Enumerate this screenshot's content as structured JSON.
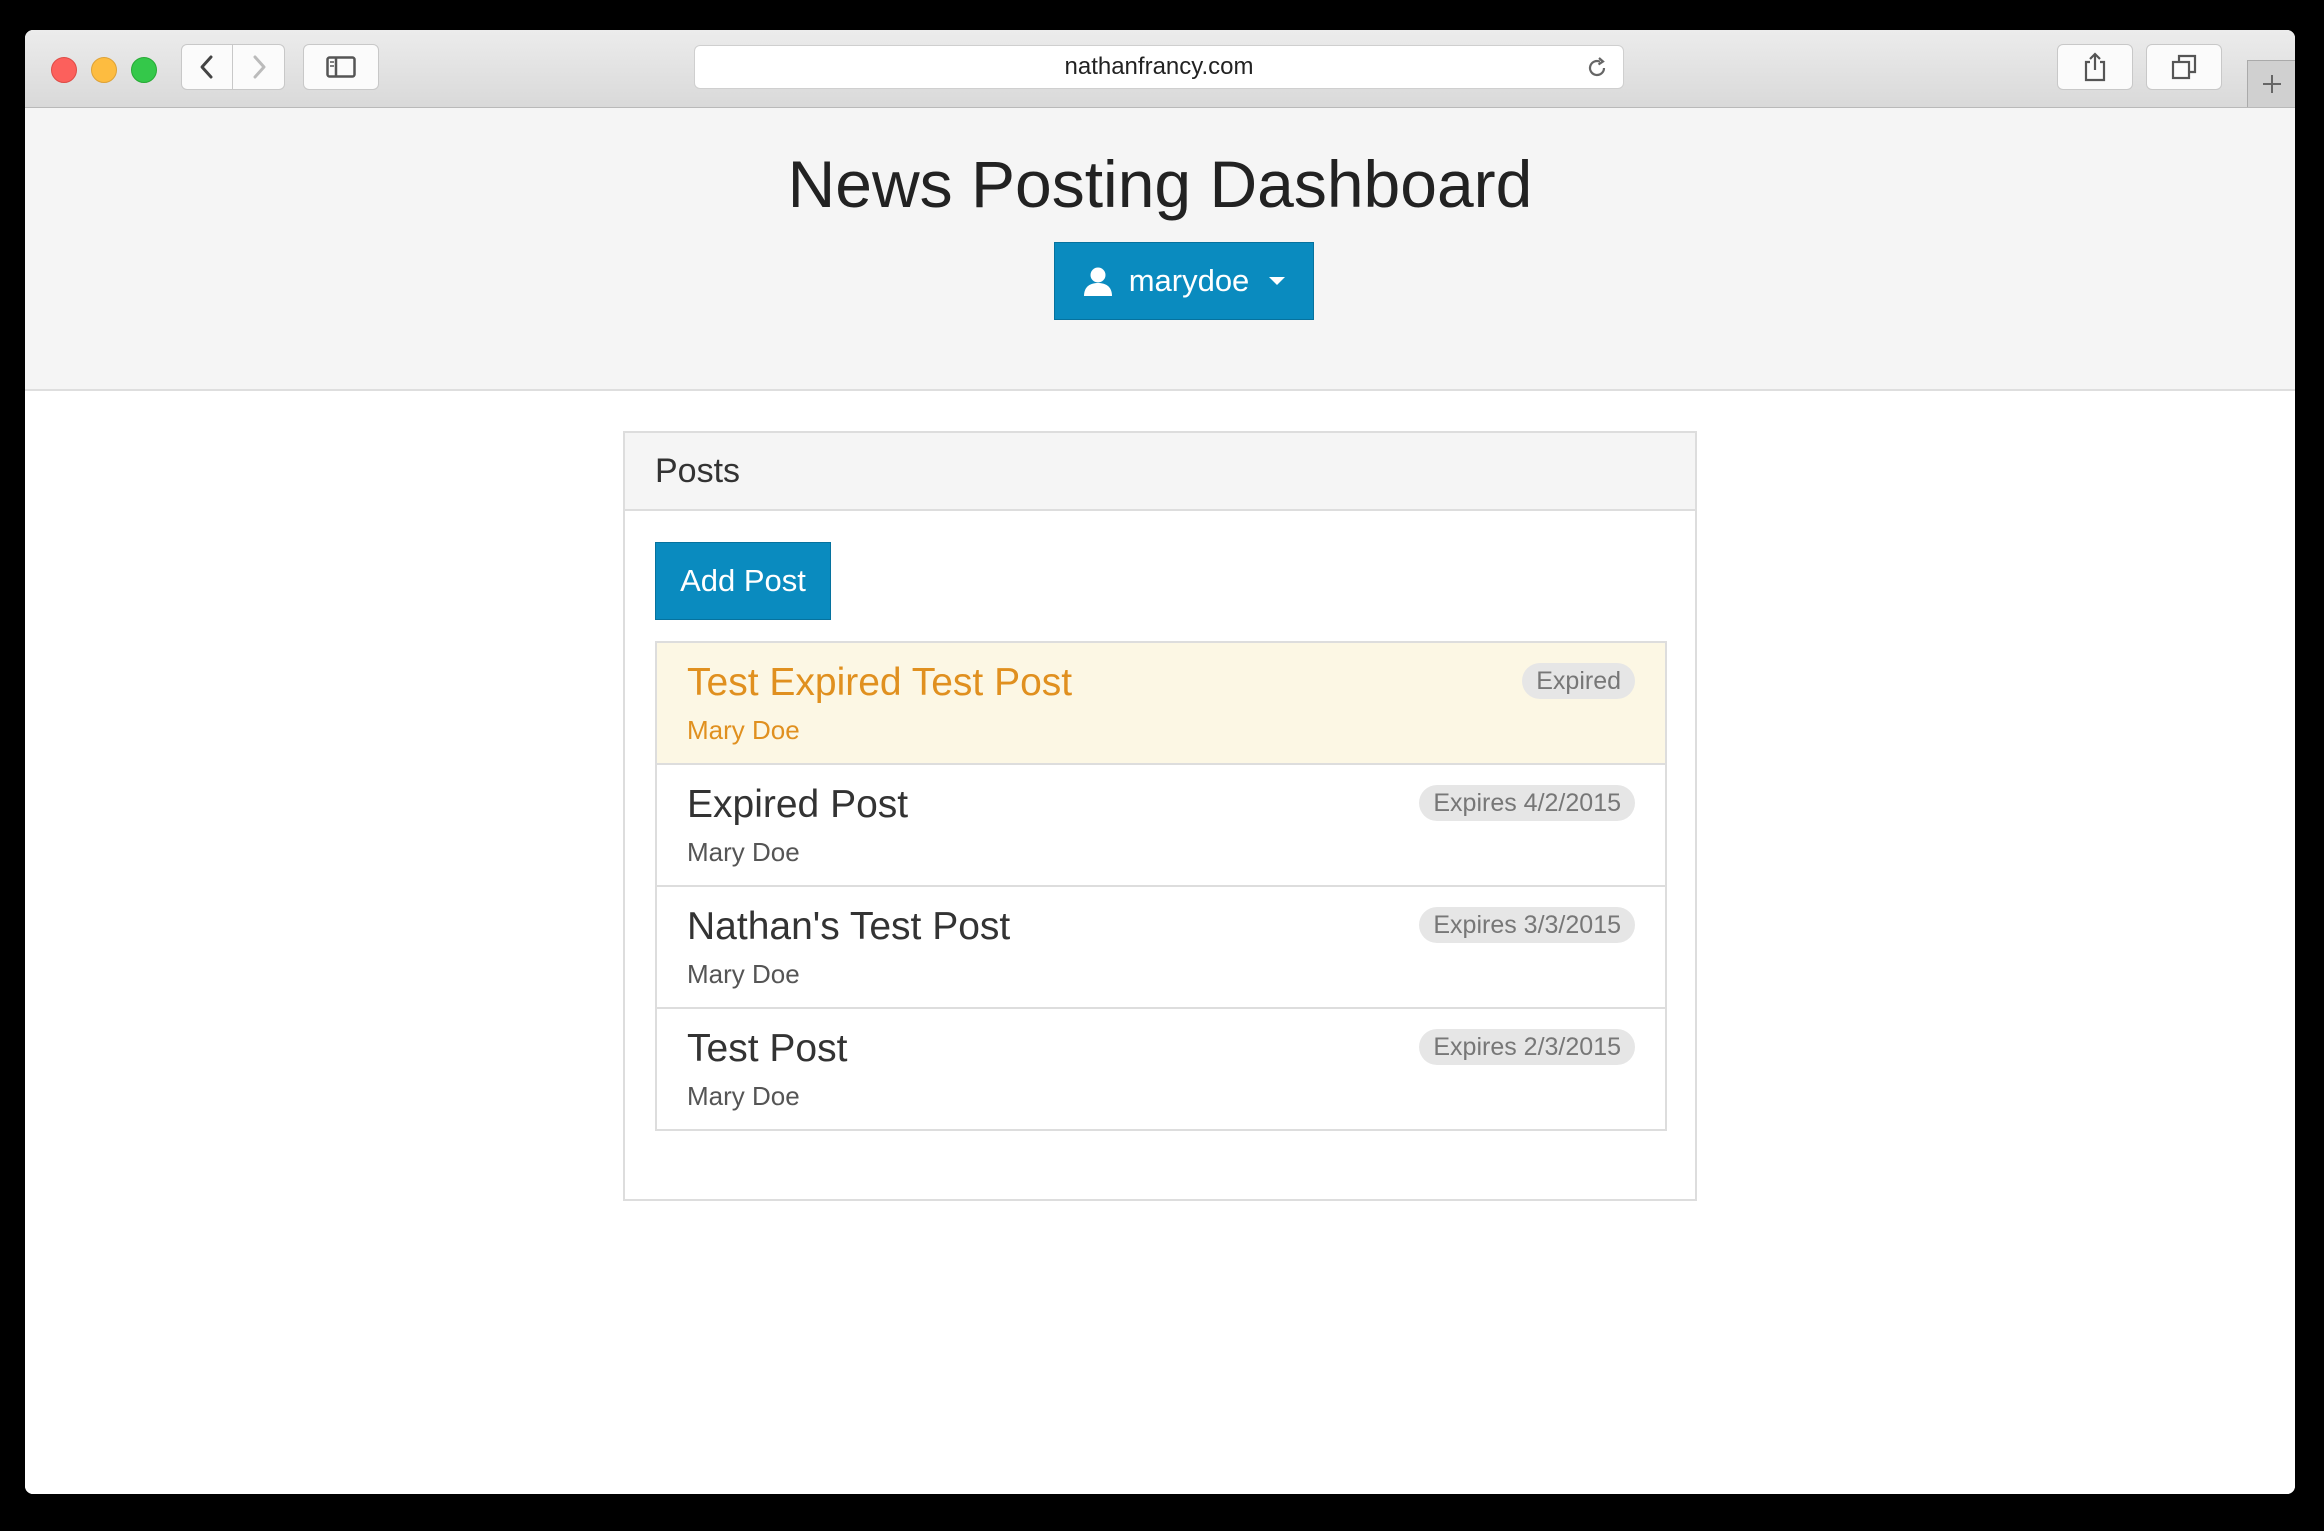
{
  "browser": {
    "url": "nathanfrancy.com"
  },
  "header": {
    "title": "News Posting Dashboard",
    "user_button_label": "marydoe"
  },
  "panel": {
    "heading": "Posts",
    "add_button_label": "Add Post"
  },
  "posts": [
    {
      "title": "Test Expired Test Post",
      "author": "Mary Doe",
      "badge": "Expired",
      "expired": true
    },
    {
      "title": "Expired Post",
      "author": "Mary Doe",
      "badge": "Expires 4/2/2015",
      "expired": false
    },
    {
      "title": "Nathan's Test Post",
      "author": "Mary Doe",
      "badge": "Expires 3/3/2015",
      "expired": false
    },
    {
      "title": "Test Post",
      "author": "Mary Doe",
      "badge": "Expires 2/3/2015",
      "expired": false
    }
  ],
  "colors": {
    "primary": "#0a8bbf",
    "expired_text": "#e0901f",
    "expired_bg": "#fcf7e4"
  }
}
